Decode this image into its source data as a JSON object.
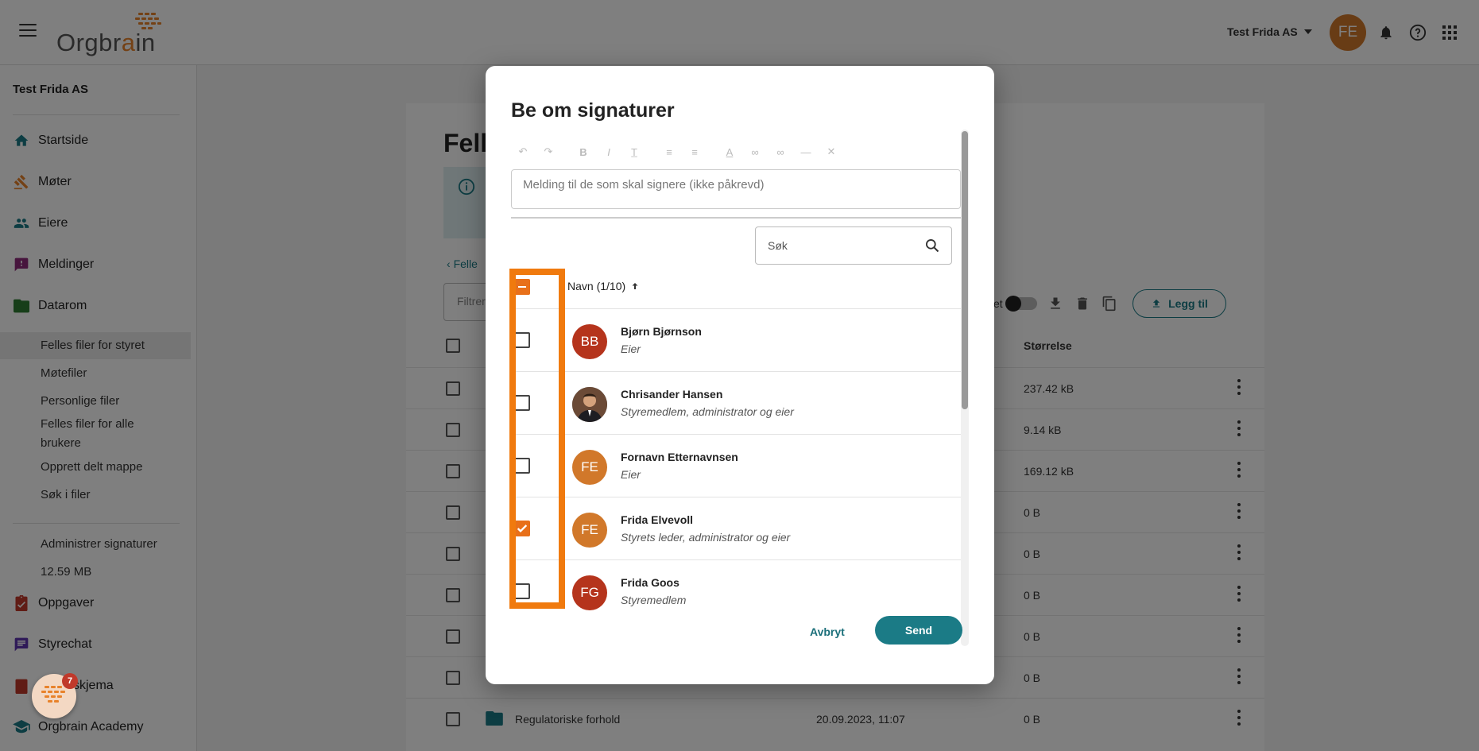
{
  "header": {
    "logo_text_main": "Orgbr",
    "logo_text_accent": "a",
    "logo_text_end": "in",
    "company": "Test Frida AS",
    "avatar_initials": "FE"
  },
  "sidebar": {
    "org_name": "Test Frida AS",
    "items": [
      {
        "label": "Startside"
      },
      {
        "label": "Møter"
      },
      {
        "label": "Eiere"
      },
      {
        "label": "Meldinger"
      },
      {
        "label": "Datarom"
      },
      {
        "label": "Oppgaver"
      },
      {
        "label": "Styrechat"
      },
      {
        "label": "skjema"
      },
      {
        "label": "Orgbrain Academy"
      }
    ],
    "sub_items": [
      {
        "label": "Felles filer for styret"
      },
      {
        "label": "Møtefiler"
      },
      {
        "label": "Personlige filer"
      },
      {
        "label": "Felles filer for alle brukere"
      },
      {
        "label": "Opprett delt mappe"
      },
      {
        "label": "Søk i filer"
      },
      {
        "label": "Administrer signaturer"
      },
      {
        "label": "12.59 MB"
      }
    ],
    "chat_badge": "7"
  },
  "main": {
    "page_title": "Fell",
    "back_link": "Felle",
    "filter_placeholder": "Filtrer",
    "toggle_label_fragment": "et",
    "add_button": "Legg til",
    "size_column": "Størrelse",
    "rows": [
      {
        "size": "237.42 kB"
      },
      {
        "size": "9.14 kB"
      },
      {
        "size": "169.12 kB"
      },
      {
        "size": "0 B"
      },
      {
        "size": "0 B"
      },
      {
        "size": "0 B"
      },
      {
        "size": "0 B"
      },
      {
        "size": "0 B"
      },
      {
        "size": "0 B",
        "name": "Regulatoriske forhold",
        "date": "20.09.2023, 11:07"
      }
    ]
  },
  "dialog": {
    "title": "Be om signaturer",
    "message_placeholder": "Melding til de som skal signere (ikke påkrevd)",
    "search_placeholder": "Søk",
    "name_header": "Navn (1/10)",
    "people": [
      {
        "name": "Bjørn Bjørnson",
        "role": "Eier",
        "initials": "BB",
        "checked": false,
        "color": "#b5341c"
      },
      {
        "name": "Chrisander Hansen",
        "role": "Styremedlem, administrator og eier",
        "initials": "",
        "checked": false,
        "color": "#3a3a3a"
      },
      {
        "name": "Fornavn Etternavnsen",
        "role": "Eier",
        "initials": "FE",
        "checked": false,
        "color": "#d1782a"
      },
      {
        "name": "Frida Elvevoll",
        "role": "Styrets leder, administrator og eier",
        "initials": "FE",
        "checked": true,
        "color": "#d1782a"
      },
      {
        "name": "Frida Goos",
        "role": "Styremedlem",
        "initials": "FG",
        "checked": false,
        "color": "#b5341c"
      }
    ],
    "cancel": "Avbryt",
    "send": "Send"
  },
  "colors": {
    "accent": "#1b7b86",
    "highlight": "#f07a0e",
    "checkbox": "#e8701a"
  }
}
